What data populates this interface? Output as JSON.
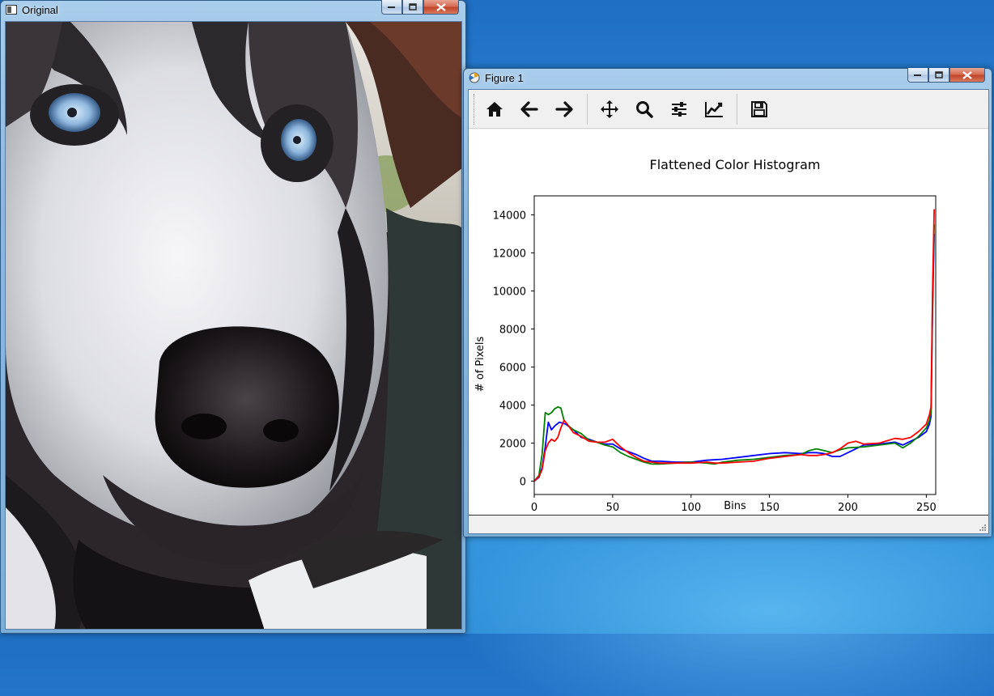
{
  "windows": {
    "original": {
      "title": "Original"
    },
    "figure": {
      "title": "Figure 1"
    }
  },
  "toolbar": {
    "buttons": [
      {
        "icon": "home-icon"
      },
      {
        "icon": "back-arrow-icon"
      },
      {
        "icon": "forward-arrow-icon"
      },
      {
        "icon": "pan-move-icon"
      },
      {
        "icon": "zoom-magnifier-icon"
      },
      {
        "icon": "configure-subplots-icon"
      },
      {
        "icon": "edit-axis-curve-icon"
      },
      {
        "icon": "save-floppy-icon"
      }
    ]
  },
  "chart_data": {
    "type": "line",
    "title": "Flattened Color Histogram",
    "xlabel": "Bins",
    "ylabel": "# of Pixels",
    "xlim": [
      0,
      256
    ],
    "ylim": [
      -700,
      15000
    ],
    "xticks": [
      "0",
      "50",
      "100",
      "150",
      "200",
      "250"
    ],
    "yticks": [
      "0",
      "2000",
      "4000",
      "6000",
      "8000",
      "10000",
      "12000",
      "14000"
    ],
    "grid": false,
    "series": [
      {
        "color": "#0000ff",
        "points": [
          [
            0,
            0
          ],
          [
            3,
            200
          ],
          [
            5,
            700
          ],
          [
            7,
            1800
          ],
          [
            9,
            3100
          ],
          [
            11,
            2700
          ],
          [
            13,
            2900
          ],
          [
            16,
            3100
          ],
          [
            18,
            3050
          ],
          [
            20,
            3000
          ],
          [
            25,
            2700
          ],
          [
            30,
            2300
          ],
          [
            35,
            2200
          ],
          [
            40,
            2050
          ],
          [
            45,
            1950
          ],
          [
            50,
            1950
          ],
          [
            55,
            1700
          ],
          [
            60,
            1550
          ],
          [
            65,
            1400
          ],
          [
            70,
            1200
          ],
          [
            75,
            1050
          ],
          [
            80,
            1050
          ],
          [
            90,
            1000
          ],
          [
            100,
            1000
          ],
          [
            110,
            1100
          ],
          [
            120,
            1150
          ],
          [
            130,
            1250
          ],
          [
            140,
            1350
          ],
          [
            150,
            1450
          ],
          [
            160,
            1500
          ],
          [
            170,
            1450
          ],
          [
            175,
            1500
          ],
          [
            180,
            1500
          ],
          [
            185,
            1450
          ],
          [
            190,
            1300
          ],
          [
            195,
            1300
          ],
          [
            200,
            1500
          ],
          [
            210,
            1900
          ],
          [
            220,
            1950
          ],
          [
            230,
            2050
          ],
          [
            235,
            1900
          ],
          [
            240,
            2100
          ],
          [
            245,
            2300
          ],
          [
            250,
            2600
          ],
          [
            252,
            3000
          ],
          [
            253,
            3400
          ],
          [
            254,
            9000
          ],
          [
            255,
            13000
          ]
        ]
      },
      {
        "color": "#008000",
        "points": [
          [
            0,
            0
          ],
          [
            3,
            300
          ],
          [
            5,
            1400
          ],
          [
            7,
            3600
          ],
          [
            9,
            3500
          ],
          [
            11,
            3600
          ],
          [
            13,
            3800
          ],
          [
            15,
            3900
          ],
          [
            17,
            3850
          ],
          [
            19,
            3200
          ],
          [
            22,
            2900
          ],
          [
            25,
            2700
          ],
          [
            30,
            2500
          ],
          [
            35,
            2150
          ],
          [
            40,
            2050
          ],
          [
            45,
            1900
          ],
          [
            50,
            1800
          ],
          [
            55,
            1500
          ],
          [
            60,
            1300
          ],
          [
            65,
            1150
          ],
          [
            70,
            1000
          ],
          [
            75,
            900
          ],
          [
            80,
            900
          ],
          [
            90,
            950
          ],
          [
            100,
            1000
          ],
          [
            110,
            950
          ],
          [
            115,
            900
          ],
          [
            120,
            1000
          ],
          [
            130,
            1100
          ],
          [
            140,
            1150
          ],
          [
            150,
            1250
          ],
          [
            160,
            1350
          ],
          [
            170,
            1400
          ],
          [
            175,
            1600
          ],
          [
            180,
            1700
          ],
          [
            185,
            1600
          ],
          [
            190,
            1500
          ],
          [
            195,
            1650
          ],
          [
            200,
            1750
          ],
          [
            210,
            1800
          ],
          [
            220,
            1900
          ],
          [
            230,
            2000
          ],
          [
            235,
            1750
          ],
          [
            240,
            2000
          ],
          [
            245,
            2350
          ],
          [
            250,
            2800
          ],
          [
            252,
            3200
          ],
          [
            253,
            3600
          ],
          [
            254,
            9500
          ],
          [
            255,
            13500
          ]
        ]
      },
      {
        "color": "#ff0000",
        "points": [
          [
            0,
            0
          ],
          [
            3,
            250
          ],
          [
            5,
            600
          ],
          [
            7,
            1600
          ],
          [
            9,
            2000
          ],
          [
            11,
            2200
          ],
          [
            13,
            2100
          ],
          [
            15,
            2300
          ],
          [
            17,
            2800
          ],
          [
            19,
            3200
          ],
          [
            21,
            3000
          ],
          [
            25,
            2550
          ],
          [
            30,
            2350
          ],
          [
            35,
            2100
          ],
          [
            40,
            2050
          ],
          [
            45,
            2050
          ],
          [
            50,
            2200
          ],
          [
            55,
            1800
          ],
          [
            60,
            1500
          ],
          [
            65,
            1250
          ],
          [
            70,
            1050
          ],
          [
            75,
            1000
          ],
          [
            80,
            950
          ],
          [
            90,
            950
          ],
          [
            100,
            950
          ],
          [
            110,
            1000
          ],
          [
            115,
            950
          ],
          [
            120,
            950
          ],
          [
            130,
            1000
          ],
          [
            140,
            1050
          ],
          [
            150,
            1200
          ],
          [
            160,
            1300
          ],
          [
            170,
            1400
          ],
          [
            175,
            1350
          ],
          [
            180,
            1350
          ],
          [
            185,
            1400
          ],
          [
            190,
            1500
          ],
          [
            195,
            1700
          ],
          [
            200,
            2000
          ],
          [
            205,
            2100
          ],
          [
            210,
            1950
          ],
          [
            220,
            2000
          ],
          [
            230,
            2250
          ],
          [
            235,
            2200
          ],
          [
            240,
            2300
          ],
          [
            245,
            2600
          ],
          [
            250,
            3000
          ],
          [
            252,
            3500
          ],
          [
            253,
            3900
          ],
          [
            254,
            10000
          ],
          [
            255,
            14300
          ]
        ]
      }
    ]
  }
}
